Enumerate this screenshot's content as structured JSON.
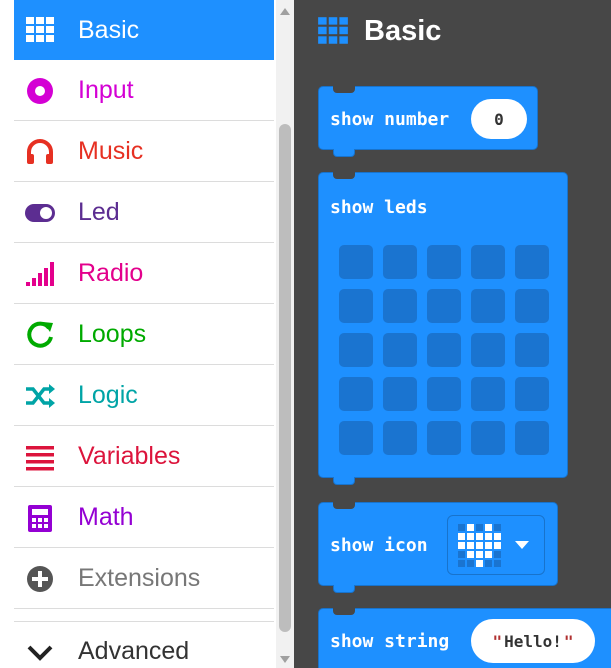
{
  "toolbox": {
    "categories": [
      {
        "label": "Basic",
        "color": "#1e90ff",
        "icon": "grid-icon",
        "selected": true
      },
      {
        "label": "Input",
        "color": "#d400d4",
        "icon": "circle-dot-icon"
      },
      {
        "label": "Music",
        "color": "#e63022",
        "icon": "headphones-icon"
      },
      {
        "label": "Led",
        "color": "#5c2d91",
        "icon": "toggle-icon"
      },
      {
        "label": "Radio",
        "color": "#e3008c",
        "icon": "signal-bars-icon"
      },
      {
        "label": "Loops",
        "color": "#00aa00",
        "icon": "refresh-icon"
      },
      {
        "label": "Logic",
        "color": "#00a4a6",
        "icon": "shuffle-icon"
      },
      {
        "label": "Variables",
        "color": "#dc143c",
        "icon": "list-lines-icon"
      },
      {
        "label": "Math",
        "color": "#9400d3",
        "icon": "calculator-icon"
      },
      {
        "label": "Extensions",
        "color": "#777777",
        "icon": "plus-circle-icon"
      },
      {
        "label": "Advanced",
        "color": "#333333",
        "icon": "chevron-down-icon"
      }
    ]
  },
  "flyout": {
    "title": "Basic",
    "blocks": {
      "show_number": {
        "label": "show number",
        "value": "0"
      },
      "show_leds": {
        "label": "show leds"
      },
      "show_icon": {
        "label": "show icon"
      },
      "show_string": {
        "label": "show string",
        "value": "Hello!",
        "quote_open": "\"",
        "quote_close": "\""
      }
    }
  },
  "colors": {
    "accent": "#1e90ff",
    "flyout_bg": "#474747",
    "led_off": "#1a74d0"
  }
}
